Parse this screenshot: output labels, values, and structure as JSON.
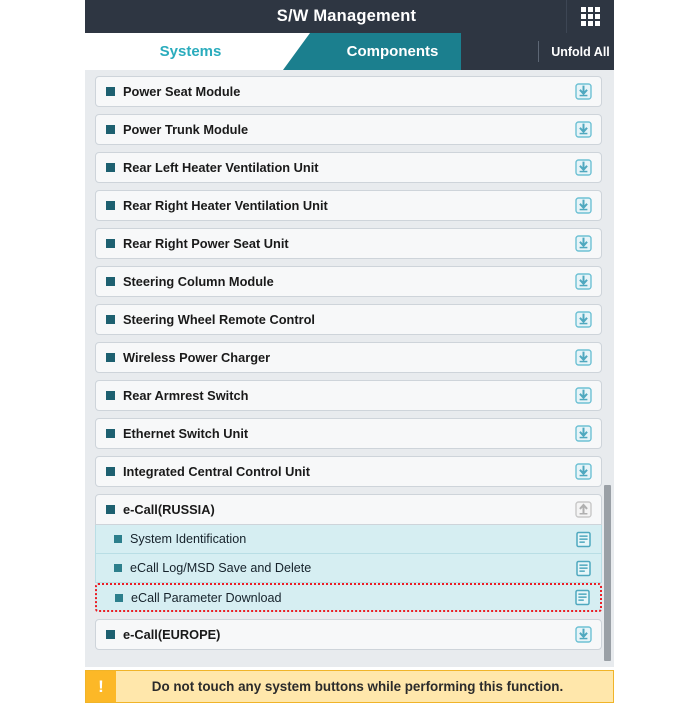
{
  "titlebar": {
    "title": "S/W Management",
    "grid_button_label": "",
    "grid_icon": "grid-menu-icon"
  },
  "tabs": {
    "active": "Systems",
    "items": [
      {
        "label": "Systems",
        "active": true
      },
      {
        "label": "Components",
        "active": false
      }
    ],
    "unfold_all_label": "Unfold All"
  },
  "colors": {
    "titlebar_bg": "#2e3642",
    "tab_teal": "#1b7f8e",
    "tab_active_text": "#2aacbd",
    "list_bg": "#e8ebee",
    "row_bg": "#f7f8f9",
    "subrow_bg": "#d6eef2",
    "bullet": "#1d6070",
    "icon_teal": "#6ec1d4",
    "selection_outline": "#ec1c24",
    "warning_bg": "#ffe7ab",
    "warning_icon_bg": "#fcb827"
  },
  "list": {
    "items": [
      {
        "label": "Power Seat Module",
        "icon": "download-icon",
        "expanded": false
      },
      {
        "label": "Power Trunk Module",
        "icon": "download-icon",
        "expanded": false
      },
      {
        "label": "Rear Left Heater Ventilation Unit",
        "icon": "download-icon",
        "expanded": false
      },
      {
        "label": "Rear Right Heater Ventilation Unit",
        "icon": "download-icon",
        "expanded": false
      },
      {
        "label": "Rear Right Power Seat Unit",
        "icon": "download-icon",
        "expanded": false
      },
      {
        "label": "Steering Column Module",
        "icon": "download-icon",
        "expanded": false
      },
      {
        "label": "Steering Wheel Remote Control",
        "icon": "download-icon",
        "expanded": false
      },
      {
        "label": "Wireless Power Charger",
        "icon": "download-icon",
        "expanded": false
      },
      {
        "label": "Rear Armrest Switch",
        "icon": "download-icon",
        "expanded": false
      },
      {
        "label": "Ethernet Switch Unit",
        "icon": "download-icon",
        "expanded": false
      },
      {
        "label": "Integrated Central Control Unit",
        "icon": "download-icon",
        "expanded": false
      }
    ],
    "group": {
      "label": "e-Call(RUSSIA)",
      "icon": "upload-icon-disabled",
      "expanded": true,
      "children": [
        {
          "label": "System Identification",
          "icon": "document-icon",
          "selected": false
        },
        {
          "label": "eCall Log/MSD Save and Delete",
          "icon": "document-icon",
          "selected": false
        },
        {
          "label": "eCall Parameter Download",
          "icon": "document-icon",
          "selected": true
        }
      ]
    },
    "last_item": {
      "label": "e-Call(EUROPE)",
      "icon": "download-icon",
      "expanded": false
    }
  },
  "warning": {
    "icon": "exclamation-icon",
    "icon_glyph": "!",
    "message": "Do not touch any system buttons while performing this function."
  }
}
